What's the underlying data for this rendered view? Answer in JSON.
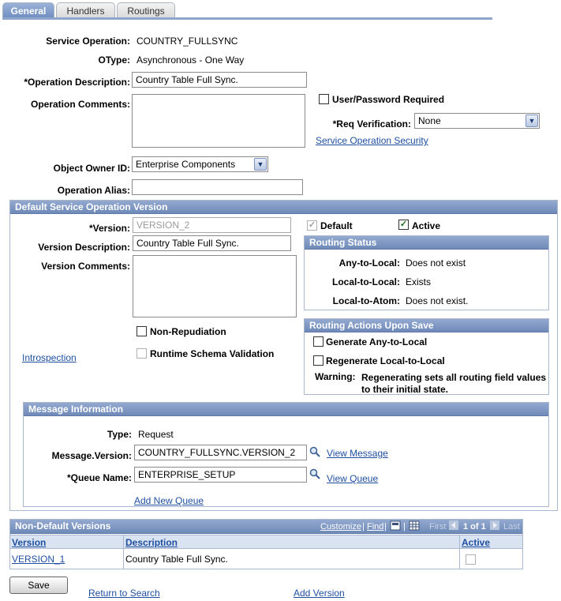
{
  "tabs": [
    "General",
    "Handlers",
    "Routings"
  ],
  "fields": {
    "service_operation_label": "Service Operation:",
    "service_operation_value": "COUNTRY_FULLSYNC",
    "otype_label": "OType:",
    "otype_value": "Asynchronous - One Way",
    "op_desc_label": "*Operation Description:",
    "op_desc_value": "Country Table Full Sync.",
    "op_comments_label": "Operation Comments:",
    "user_pwd_label": "User/Password Required",
    "req_verification_label": "*Req Verification:",
    "req_verification_value": "None",
    "service_op_security_link": "Service Operation Security",
    "object_owner_label": "Object Owner ID:",
    "object_owner_value": "Enterprise Components",
    "op_alias_label": "Operation Alias:",
    "op_alias_value": ""
  },
  "default_version": {
    "header": "Default Service Operation Version",
    "version_label": "*Version:",
    "version_value": "VERSION_2",
    "version_desc_label": "Version Description:",
    "version_desc_value": "Country Table Full Sync.",
    "version_comments_label": "Version Comments:",
    "default_label": "Default",
    "active_label": "Active",
    "non_repudiation_label": "Non-Repudiation",
    "runtime_schema_label": "Runtime Schema Validation",
    "introspection_link": "Introspection"
  },
  "routing_status": {
    "header": "Routing Status",
    "rows": [
      {
        "label": "Any-to-Local:",
        "value": "Does not exist"
      },
      {
        "label": "Local-to-Local:",
        "value": "Exists"
      },
      {
        "label": "Local-to-Atom:",
        "value": "Does not exist."
      }
    ]
  },
  "routing_actions": {
    "header": "Routing Actions Upon Save",
    "generate_label": "Generate Any-to-Local",
    "regenerate_label": "Regenerate Local-to-Local",
    "warning_label": "Warning:",
    "warning_line1": "Regenerating sets all routing field values",
    "warning_line2": "to their initial state."
  },
  "message_info": {
    "header": "Message Information",
    "type_label": "Type:",
    "type_value": "Request",
    "msg_version_label": "Message.Version:",
    "msg_version_value": "COUNTRY_FULLSYNC.VERSION_2",
    "view_message_link": "View Message",
    "queue_label": "*Queue Name:",
    "queue_value": "ENTERPRISE_SETUP",
    "view_queue_link": "View Queue",
    "add_queue_link": "Add New Queue"
  },
  "non_default": {
    "header": "Non-Default Versions",
    "customize": "Customize",
    "find": "Find",
    "first": "First",
    "pager": "1 of 1",
    "last": "Last",
    "columns": [
      "Version",
      "Description",
      "Active"
    ],
    "rows": [
      {
        "version": "VERSION_1",
        "description": "Country Table Full Sync.",
        "active": false
      }
    ]
  },
  "footer": {
    "save": "Save",
    "return_to_search": "Return to Search",
    "add_version": "Add Version"
  }
}
